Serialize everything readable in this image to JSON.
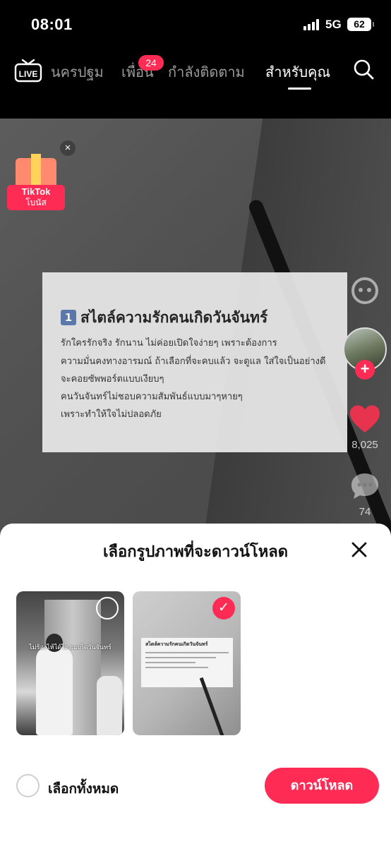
{
  "status_bar": {
    "time": "08:01",
    "network": "5G",
    "battery": "62"
  },
  "top_nav": {
    "live_label": "LIVE",
    "tabs": [
      {
        "label": "นครปฐม"
      },
      {
        "label": "เพื่อน"
      },
      {
        "label": "กำลังติดตาม"
      },
      {
        "label": "สำหรับคุณ"
      }
    ],
    "friends_badge": "24",
    "active_tab": "สำหรับคุณ"
  },
  "video": {
    "gift_widget": {
      "line1": "TikTok",
      "line2": "โบนัส"
    },
    "card": {
      "number": "1",
      "title": "สไตล์ความรักคนเกิดวันจันทร์",
      "lines": [
        "รักใครรักจริง รักนาน ไม่ค่อยเปิดใจง่ายๆ เพราะต้องการ",
        "ความมั่นคงทางอารมณ์ ถ้าเลือกที่จะคบแล้ว จะดูแล ใส่ใจเป็นอย่างดี",
        "จะคอยซัพพอร์ตแบบเงียบๆ",
        "คนวันจันทร์ไม่ชอบความสัมพันธ์แบบมาๆหายๆ",
        "เพราะทำให้ใจไม่ปลอดภัย"
      ]
    },
    "side": {
      "likes": "8,025",
      "comments": "74"
    }
  },
  "sheet": {
    "title": "เลือกรูปภาพที่จะดาวน์โหลด",
    "thumbnails": [
      {
        "caption": "ไม่ร้องไห้ได้ไง ผมเกิดวันจันทร์",
        "selected": false
      },
      {
        "caption": "สไตล์ความรักคนเกิดวันจันทร์",
        "selected": true
      }
    ],
    "select_all_label": "เลือกทั้งหมด",
    "download_label": "ดาวน์โหลด"
  },
  "colors": {
    "accent": "#fe2c55"
  }
}
